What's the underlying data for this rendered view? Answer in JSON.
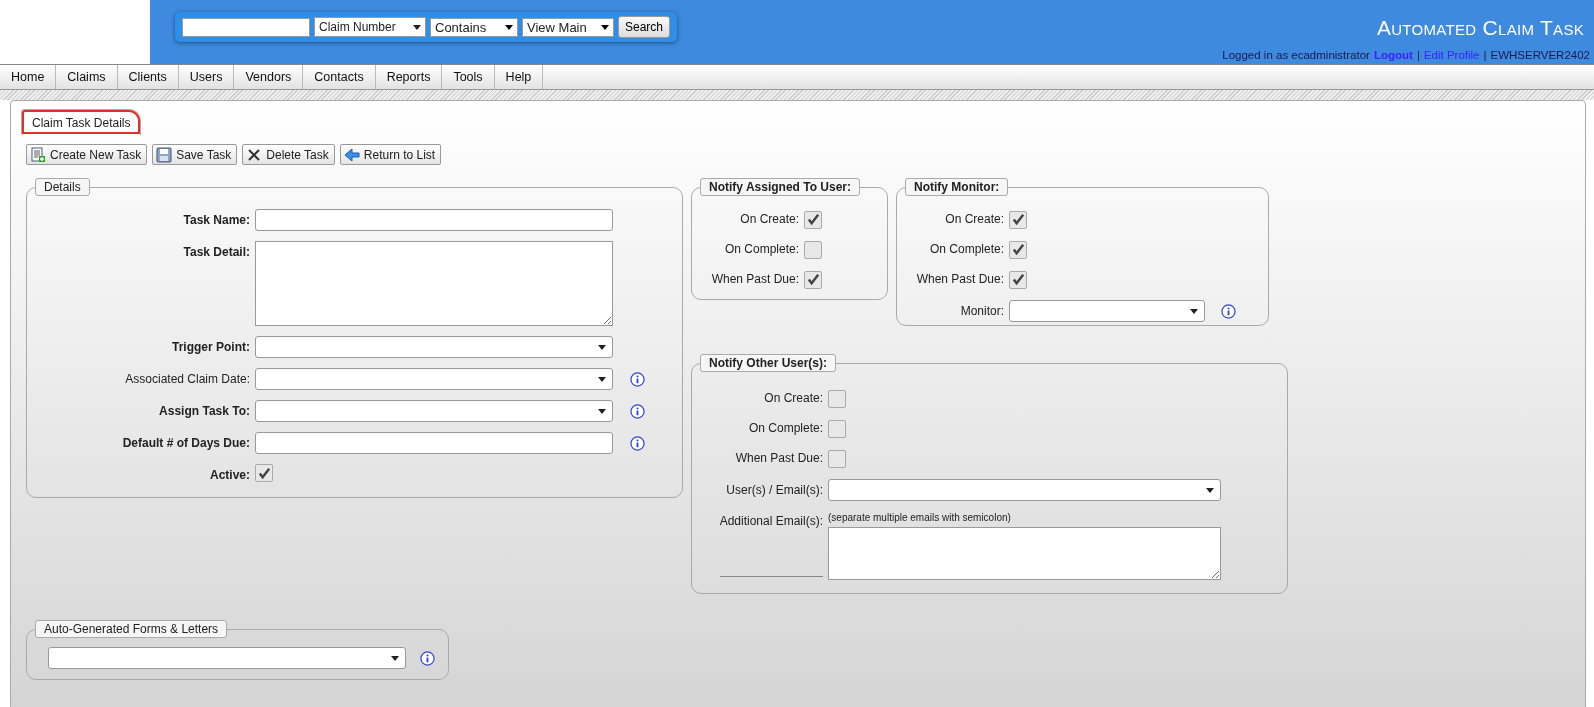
{
  "header": {
    "search_by": "Claim Number",
    "match": "Contains",
    "view": "View Main",
    "search_button": "Search",
    "title": "Automated Claim Task",
    "user_info": [
      {
        "text": "Logged in as ecadministrator",
        "kind": "text"
      },
      {
        "text": "Logout",
        "kind": "strong-link"
      },
      {
        "text": "|",
        "kind": "separator"
      },
      {
        "text": "Edit Profile",
        "kind": "link"
      },
      {
        "text": "|",
        "kind": "separator"
      },
      {
        "text": "EWHSERVER2402",
        "kind": "text"
      }
    ]
  },
  "nav": [
    "Home",
    "Claims",
    "Clients",
    "Users",
    "Vendors",
    "Contacts",
    "Reports",
    "Tools",
    "Help"
  ],
  "tabs": [
    {
      "label": "Claim Task Details",
      "selected": true,
      "highlighted": true
    }
  ],
  "toolbar": [
    {
      "label": "Create New Task",
      "kind": "create"
    },
    {
      "label": "Save Task",
      "kind": "save"
    },
    {
      "label": "Delete Task",
      "kind": "delete"
    },
    {
      "label": "Return to List",
      "kind": "return"
    }
  ],
  "details": {
    "title": "Details",
    "fields": [
      {
        "label": "Task Name:",
        "kind": "text",
        "bold": true,
        "info": false
      },
      {
        "label": "Task Detail:",
        "kind": "textarea",
        "bold": true,
        "info": false
      },
      {
        "label": "Trigger Point:",
        "kind": "select",
        "bold": true,
        "info": false
      },
      {
        "label": "Associated Claim Date:",
        "kind": "select",
        "bold": false,
        "info": true
      },
      {
        "label": "Assign Task To:",
        "kind": "select",
        "bold": true,
        "info": true
      },
      {
        "label": "Default # of Days Due:",
        "kind": "text",
        "bold": true,
        "info": true
      },
      {
        "label": "Active:",
        "kind": "checkbox",
        "bold": true,
        "info": false,
        "checked": true
      }
    ]
  },
  "notify_assigned": {
    "title": "Notify Assigned To User:",
    "options": [
      {
        "label": "On Create:",
        "checked": true
      },
      {
        "label": "On Complete:",
        "checked": false
      },
      {
        "label": "When Past Due:",
        "checked": true
      }
    ]
  },
  "notify_monitor": {
    "title": "Notify Monitor:",
    "options": [
      {
        "label": "On Create:",
        "checked": true
      },
      {
        "label": "On Complete:",
        "checked": true
      },
      {
        "label": "When Past Due:",
        "checked": true
      }
    ],
    "monitor": {
      "label": "Monitor:",
      "info": true
    }
  },
  "notify_other": {
    "title": "Notify Other User(s):",
    "options": [
      {
        "label": "On Create:",
        "checked": false
      },
      {
        "label": "On Complete:",
        "checked": false
      },
      {
        "label": "When Past Due:",
        "checked": false
      }
    ],
    "users": {
      "label": "User(s) / Email(s):"
    },
    "additional": {
      "label": "Additional Email(s):",
      "hint": "(separate multiple emails with semicolon)"
    }
  },
  "auto_forms": {
    "title": "Auto-Generated Forms & Letters",
    "info": true
  }
}
